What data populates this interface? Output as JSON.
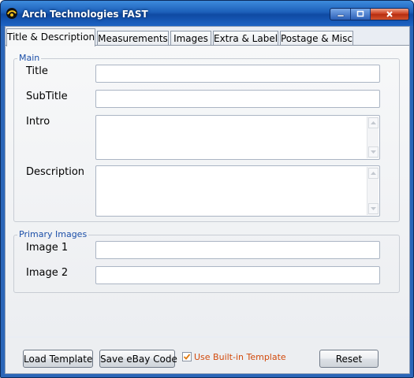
{
  "window": {
    "title": "Arch Technologies FAST"
  },
  "tabs": [
    {
      "label": "Title & Description",
      "active": true
    },
    {
      "label": "Measurements",
      "active": false
    },
    {
      "label": "Images",
      "active": false
    },
    {
      "label": "Extra & Label",
      "active": false
    },
    {
      "label": "Postage & Misc",
      "active": false
    }
  ],
  "main_group": {
    "legend": "Main",
    "title_label": "Title",
    "title_value": "",
    "subtitle_label": "SubTitle",
    "subtitle_value": "",
    "intro_label": "Intro",
    "intro_value": "",
    "description_label": "Description",
    "description_value": ""
  },
  "images_group": {
    "legend": "Primary Images",
    "image1_label": "Image 1",
    "image1_value": "",
    "image2_label": "Image 2",
    "image2_value": ""
  },
  "footer": {
    "load_template_label": "Load Template",
    "save_ebay_label": "Save eBay Code",
    "use_builtin_label": "Use Built-in Template",
    "use_builtin_checked": true,
    "reset_label": "Reset"
  },
  "icons": {
    "app": "app-logo-icon",
    "minimize": "minimize-icon",
    "maximize": "maximize-icon",
    "close": "close-icon",
    "scroll_up": "scroll-up-arrow-icon",
    "scroll_down": "scroll-down-arrow-icon",
    "checkmark": "checkmark-icon"
  },
  "colors": {
    "title_bar": "#1c5fb9",
    "close_button": "#c83818",
    "legend_text": "#1c4fa8",
    "checkbox_label": "#d24a0c"
  }
}
